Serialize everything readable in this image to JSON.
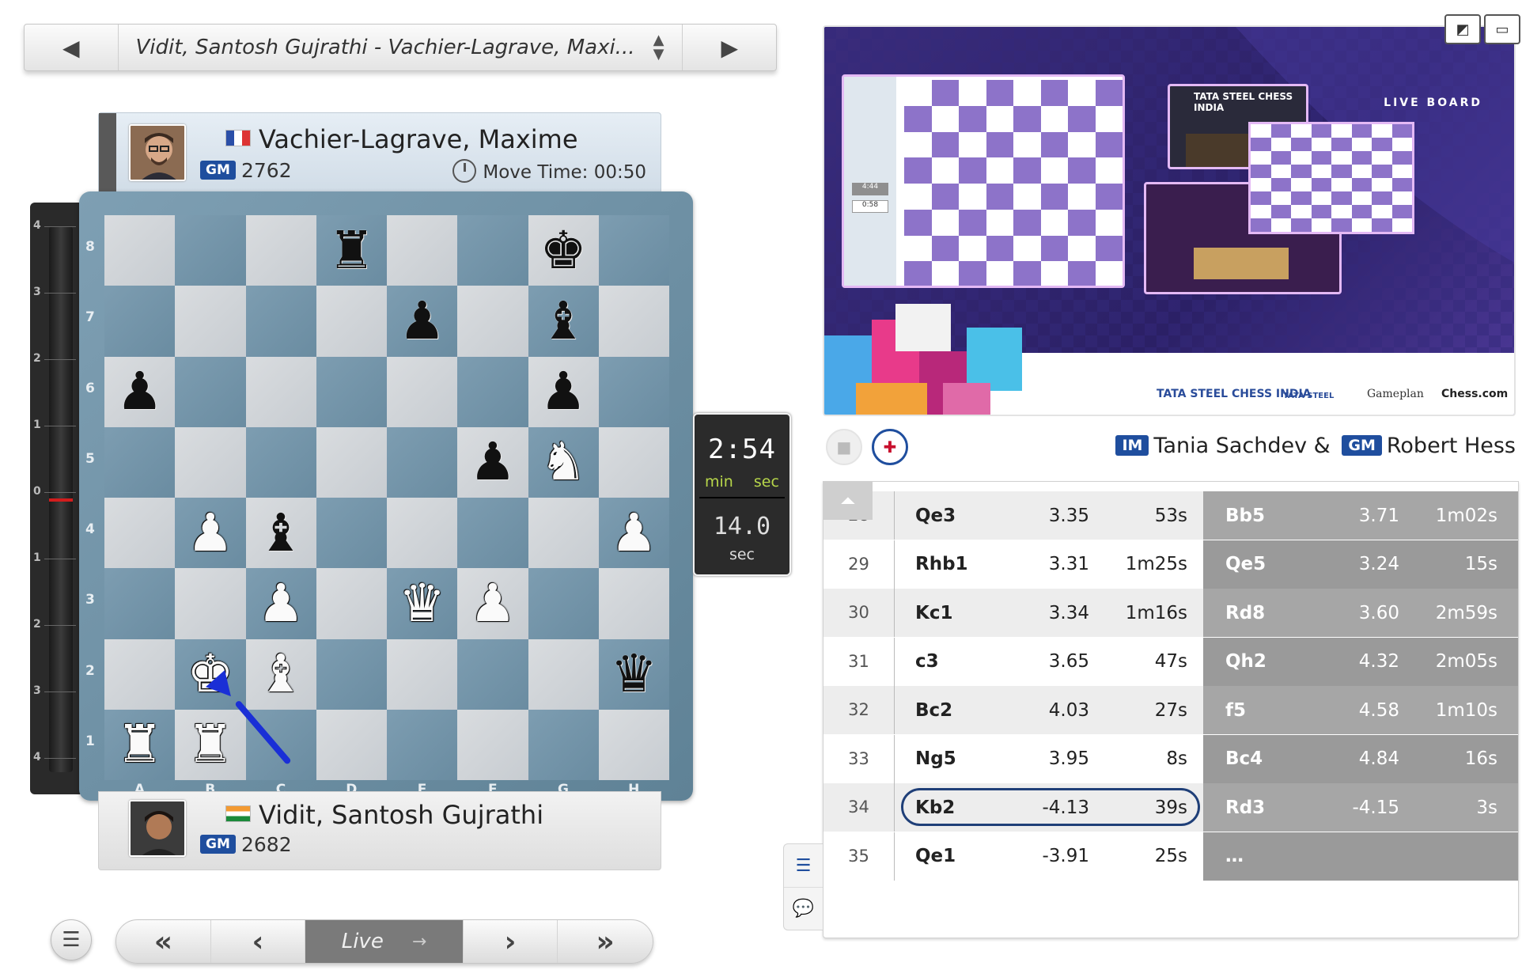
{
  "game_selector": {
    "title": "Vidit, Santosh Gujrathi - Vachier-Lagrave, Maxi...",
    "prev_icon": "triangle-left",
    "next_icon": "triangle-right",
    "dropdown_icon": "up-down-arrows"
  },
  "top_player": {
    "name": "Vachier-Lagrave, Maxime",
    "flag": "France",
    "title": "GM",
    "rating": "2762",
    "move_time_label": "Move Time: 00:50"
  },
  "bottom_player": {
    "name": "Vidit, Santosh Gujrathi",
    "flag": "India",
    "title": "GM",
    "rating": "2682"
  },
  "eval_bar": {
    "ticks": [
      "4",
      "3",
      "2",
      "1",
      "0",
      "1",
      "2",
      "3",
      "4"
    ]
  },
  "board": {
    "ranks": [
      "8",
      "7",
      "6",
      "5",
      "4",
      "3",
      "2",
      "1"
    ],
    "files": [
      "A",
      "B",
      "C",
      "D",
      "E",
      "F",
      "G",
      "H"
    ],
    "fen_rows": [
      "3r2k1",
      "4p1b1",
      "p5p1",
      "5pN1",
      "1Pb4P",
      "2P1QP2",
      "1KB4q",
      "RR6"
    ],
    "arrow": {
      "from": "c1",
      "to": "b2",
      "color": "#1a2fd6"
    }
  },
  "clock": {
    "time": "2:54",
    "min_label": "min",
    "sec_label": "sec",
    "increment": "14.0",
    "increment_unit": "sec"
  },
  "nav": {
    "menu_icon": "hamburger-icon",
    "first": "«",
    "prev": "‹",
    "live": "Live",
    "next": "›",
    "last": "»"
  },
  "video": {
    "live_board_label": "LIVE BOARD",
    "sponsors": [
      "TATA STEEL CHESS INDIA",
      "TATA STEEL",
      "Gameplan",
      "Chess.com"
    ],
    "event_logo": "TATA STEEL CHESS INDIA",
    "mini_clocks": [
      "4:44",
      "0:58"
    ]
  },
  "commentary": {
    "commentator1_title": "IM",
    "commentator1": "Tania Sachdev &",
    "commentator2_title": "GM",
    "commentator2": "Robert Hess"
  },
  "moves": [
    {
      "num": "28",
      "white": "Qe3",
      "w_eval": "3.35",
      "w_time": "53s",
      "black": "Bb5",
      "b_eval": "3.71",
      "b_time": "1m02s"
    },
    {
      "num": "29",
      "white": "Rhb1",
      "w_eval": "3.31",
      "w_time": "1m25s",
      "black": "Qe5",
      "b_eval": "3.24",
      "b_time": "15s"
    },
    {
      "num": "30",
      "white": "Kc1",
      "w_eval": "3.34",
      "w_time": "1m16s",
      "black": "Rd8",
      "b_eval": "3.60",
      "b_time": "2m59s"
    },
    {
      "num": "31",
      "white": "c3",
      "w_eval": "3.65",
      "w_time": "47s",
      "black": "Qh2",
      "b_eval": "4.32",
      "b_time": "2m05s"
    },
    {
      "num": "32",
      "white": "Bc2",
      "w_eval": "4.03",
      "w_time": "27s",
      "black": "f5",
      "b_eval": "4.58",
      "b_time": "1m10s"
    },
    {
      "num": "33",
      "white": "Ng5",
      "w_eval": "3.95",
      "w_time": "8s",
      "black": "Bc4",
      "b_eval": "4.84",
      "b_time": "16s"
    },
    {
      "num": "34",
      "white": "Kb2",
      "w_eval": "-4.13",
      "w_time": "39s",
      "black": "Rd3",
      "b_eval": "-4.15",
      "b_time": "3s",
      "current": true
    },
    {
      "num": "35",
      "white": "Qe1",
      "w_eval": "-3.91",
      "w_time": "25s",
      "black": "…",
      "b_eval": "",
      "b_time": ""
    }
  ],
  "colors": {
    "accent_blue": "#1f4e9e",
    "board_dark": "#6a8ca1",
    "board_light": "#d3d7db",
    "eval_zero": "#d21d1d",
    "clock_units": "#b7d64a"
  }
}
